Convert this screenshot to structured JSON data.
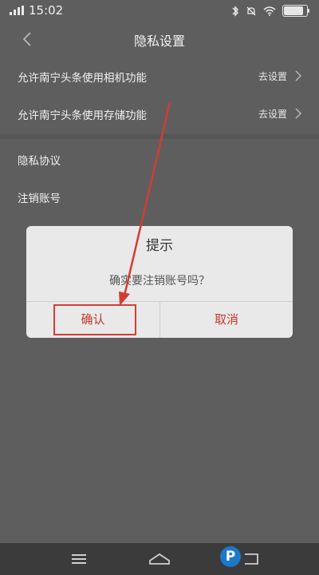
{
  "status_bar": {
    "time": "15:02"
  },
  "nav": {
    "title": "隐私设置"
  },
  "settings": {
    "items": [
      {
        "label": "允许南宁头条使用相机功能",
        "action": "去设置"
      },
      {
        "label": "允许南宁头条使用存储功能",
        "action": "去设置"
      },
      {
        "label": "隐私协议"
      },
      {
        "label": "注销账号"
      }
    ]
  },
  "dialog": {
    "title": "提示",
    "message": "确实要注销账号吗？",
    "confirm_label": "确认",
    "cancel_label": "取消"
  },
  "colors": {
    "accent": "#c9362d",
    "highlight": "#d23d33"
  }
}
